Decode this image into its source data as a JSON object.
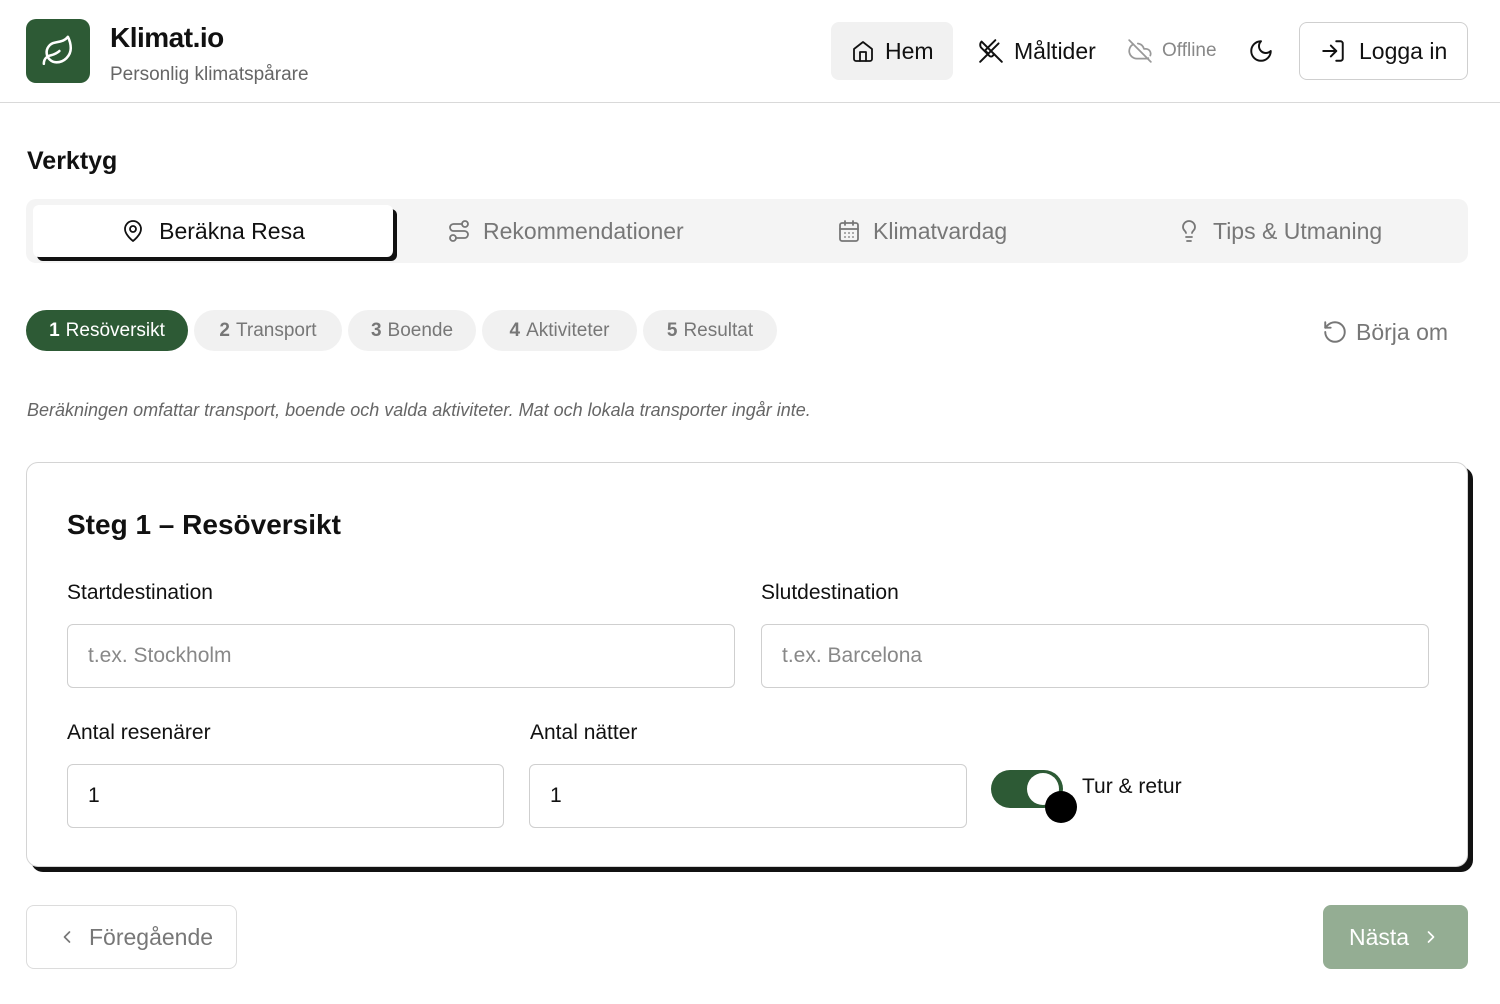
{
  "header": {
    "brand_title": "Klimat.io",
    "brand_subtitle": "Personlig klimatspårare",
    "nav": {
      "home": "Hem",
      "meals": "Måltider",
      "offline": "Offline",
      "login": "Logga in"
    }
  },
  "section_title": "Verktyg",
  "tabs": [
    {
      "label": "Beräkna Resa",
      "icon": "map-pin-icon",
      "active": true
    },
    {
      "label": "Rekommendationer",
      "icon": "route-icon",
      "active": false
    },
    {
      "label": "Klimatvardag",
      "icon": "calendar-icon",
      "active": false
    },
    {
      "label": "Tips & Utmaning",
      "icon": "lightbulb-icon",
      "active": false
    }
  ],
  "steps": [
    {
      "num": "1",
      "label": "Resöversikt",
      "active": true
    },
    {
      "num": "2",
      "label": "Transport",
      "active": false
    },
    {
      "num": "3",
      "label": "Boende",
      "active": false
    },
    {
      "num": "4",
      "label": "Aktiviteter",
      "active": false
    },
    {
      "num": "5",
      "label": "Resultat",
      "active": false
    }
  ],
  "restart_label": "Börja om",
  "info_text": "Beräkningen omfattar transport, boende och valda aktiviteter. Mat och lokala transporter ingår inte.",
  "card": {
    "title": "Steg 1 – Resöversikt",
    "start_label": "Startdestination",
    "start_placeholder": "t.ex. Stockholm",
    "end_label": "Slutdestination",
    "end_placeholder": "t.ex. Barcelona",
    "travelers_label": "Antal resenärer",
    "travelers_value": "1",
    "nights_label": "Antal nätter",
    "nights_value": "1",
    "roundtrip_label": "Tur & retur",
    "roundtrip_on": true
  },
  "buttons": {
    "prev": "Föregående",
    "next": "Nästa"
  },
  "colors": {
    "primary": "#2d5a35",
    "primary_disabled": "#94ad93"
  }
}
